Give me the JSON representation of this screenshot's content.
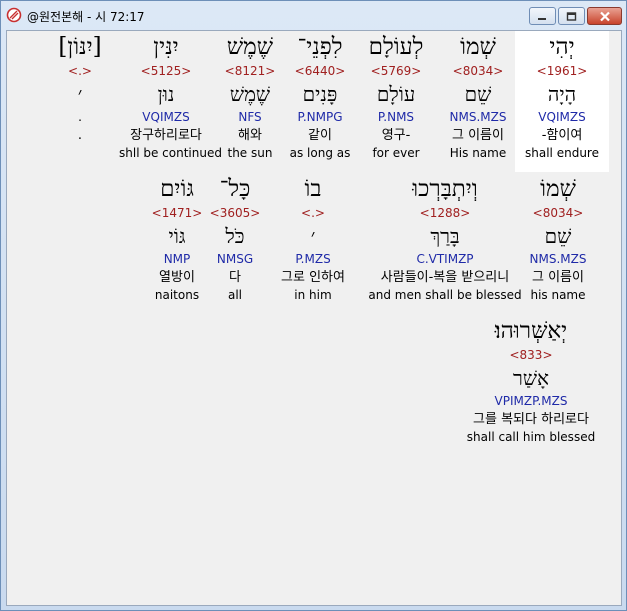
{
  "window": {
    "title": "@원전본해 - 시 72:17",
    "controls": {
      "minimize": "minimize",
      "maximize": "maximize",
      "close": "close"
    }
  },
  "rows": [
    {
      "words": [
        {
          "heb": "יְהִי",
          "strong": "<1961>",
          "lex": "הָיָה",
          "parse": "VQIMZS",
          "kor": "-함이여",
          "eng": "shall endure",
          "highlight": true
        },
        {
          "heb": "שְׁמוֹ",
          "strong": "<8034>",
          "lex": "שֵׁם",
          "parse": "NMS.MZS",
          "kor": "그 이름이",
          "eng": "His name"
        },
        {
          "heb": "לְעוֹלָם",
          "strong": "<5769>",
          "lex": "עוֹלָם",
          "parse": "P.NMS",
          "kor": "영구-",
          "eng": "for ever"
        },
        {
          "heb": "לִפְנֵי־",
          "strong": "<6440>",
          "lex": "פָּנִים",
          "parse": "P.NMPG",
          "kor": "같이",
          "eng": "as long as"
        },
        {
          "heb": "שֶׁמֶשׁ",
          "strong": "<8121>",
          "lex": "שֶׁמֶשׁ",
          "parse": "NFS",
          "kor": "해와",
          "eng": "the sun"
        },
        {
          "heb": "יִנִּין",
          "strong": "<5125>",
          "lex": "נוּן",
          "parse": "VQIMZS",
          "kor": "장구하리로다",
          "eng": "shll be continued"
        },
        {
          "heb": "[יִנּוֹן]",
          "strong": "<.>",
          "lex": "׳",
          "parse": ".",
          "kor": ".",
          "eng": ""
        }
      ]
    },
    {
      "words": [
        {
          "heb": "שְׁמוֹ",
          "strong": "<8034>",
          "lex": "שֵׁם",
          "parse": "NMS.MZS",
          "kor": "그 이름이",
          "eng": "his name"
        },
        {
          "heb": "וְיִתְבָּרְכוּ",
          "strong": "<1288>",
          "lex": "בָּרַךְ",
          "parse": "C.VTIMZP",
          "kor": "사람들이-복을 받으리니",
          "eng": "and men shall be blessed"
        },
        {
          "heb": "בוֹ",
          "strong": "<.>",
          "lex": "׳",
          "parse": "P.MZS",
          "kor": "그로 인하여",
          "eng": "in him"
        },
        {
          "heb": "כָּל־",
          "strong": "<3605>",
          "lex": "כֹּל",
          "parse": "NMSG",
          "kor": "다",
          "eng": "all"
        },
        {
          "heb": "גּוֹיִם",
          "strong": "<1471>",
          "lex": "גּוֹי",
          "parse": "NMP",
          "kor": "열방이",
          "eng": "naitons"
        }
      ]
    },
    {
      "words": [
        {
          "heb": "יְאַשְּׁרוּהוּ׃",
          "strong": "<833>",
          "lex": "אָשַׁר",
          "parse": "VPIMZP.MZS",
          "kor": "그를 복되다 하리로다",
          "eng": "shall call him blessed"
        }
      ]
    }
  ]
}
